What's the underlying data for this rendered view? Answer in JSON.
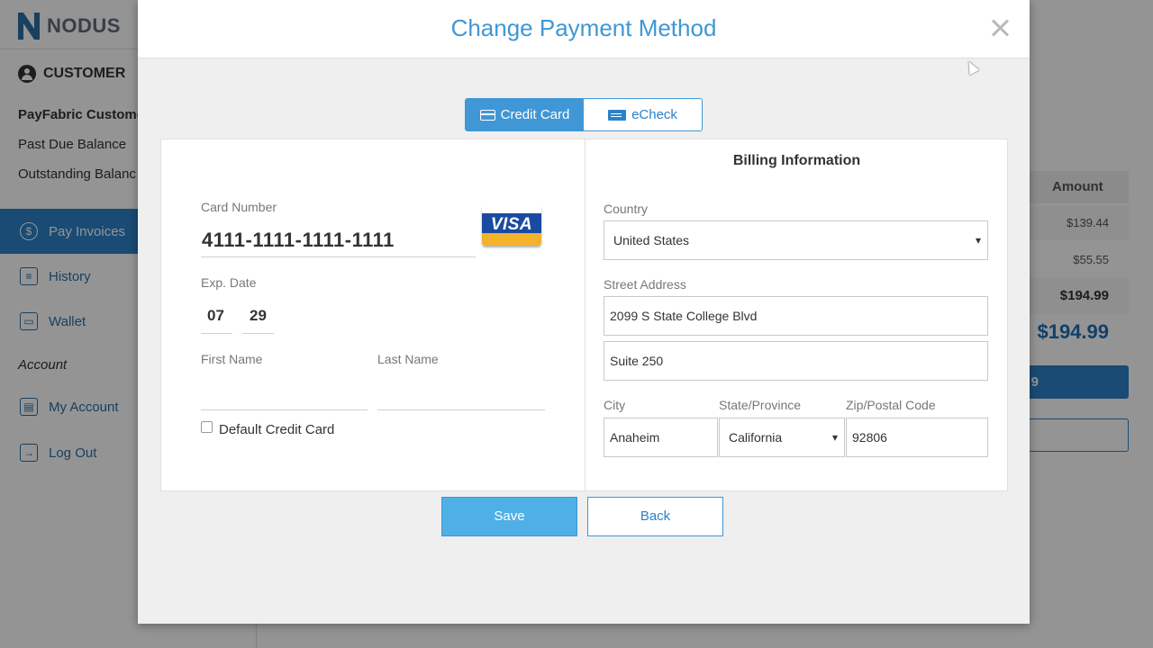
{
  "app": {
    "logo_text": "NODUS",
    "customer_label": "CUSTOMER",
    "customer_name": "PayFabric Custome",
    "past_due": "Past Due Balance",
    "outstanding": "Outstanding Balanc",
    "nav": [
      {
        "label": "Pay Invoices",
        "icon": "dollar-icon"
      },
      {
        "label": "History",
        "icon": "list-icon"
      },
      {
        "label": "Wallet",
        "icon": "wallet-icon"
      }
    ],
    "account_label": "Account",
    "nav2": [
      {
        "label": "My Account",
        "icon": "user-card-icon"
      },
      {
        "label": "Log Out",
        "icon": "logout-icon"
      }
    ],
    "amount_header": "Amount",
    "amounts": [
      "$139.44",
      "$55.55"
    ],
    "total": "$194.99",
    "total_big": "$194.99",
    "pay_button_fragment": "9"
  },
  "modal": {
    "title": "Change Payment Method",
    "tabs": [
      {
        "label": "Credit Card",
        "active": true
      },
      {
        "label": "eCheck",
        "active": false
      }
    ],
    "card": {
      "number_label": "Card Number",
      "number": "4111-1111-1111-1111",
      "brand": "VISA",
      "exp_label": "Exp. Date",
      "exp_month": "07",
      "exp_year": "29",
      "first_name_label": "First Name",
      "first_name": "",
      "last_name_label": "Last Name",
      "last_name": "",
      "default_label": "Default Credit Card",
      "default_checked": false
    },
    "billing": {
      "title": "Billing Information",
      "country_label": "Country",
      "country": "United States",
      "street_label": "Street Address",
      "street1": "2099 S State College Blvd",
      "street2": "Suite 250",
      "city_label": "City",
      "city": "Anaheim",
      "state_label": "State/Province",
      "state": "California",
      "zip_label": "Zip/Postal Code",
      "zip": "92806"
    },
    "save_label": "Save",
    "back_label": "Back"
  },
  "colors": {
    "accent": "#3f97d6",
    "nav_active": "#2b82c9",
    "total": "#1f6fb5"
  }
}
